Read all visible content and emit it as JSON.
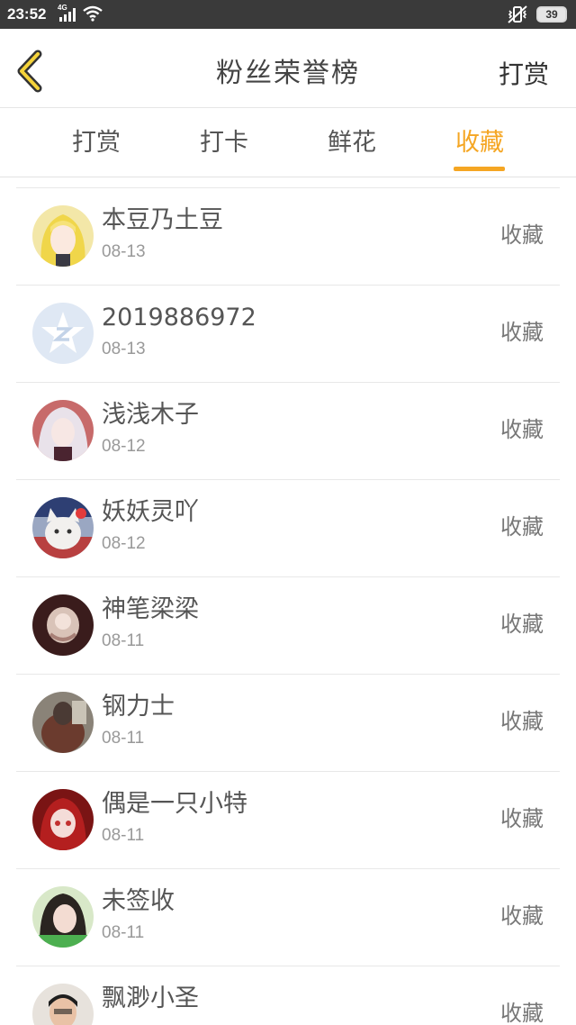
{
  "status_bar": {
    "time": "23:52",
    "network": "4G",
    "battery": "39"
  },
  "header": {
    "title": "粉丝荣誉榜",
    "action_label": "打赏",
    "back_icon": "chevron-left-icon",
    "accent_color": "#f5a623"
  },
  "tabs": [
    {
      "label": "打赏",
      "active": false
    },
    {
      "label": "打卡",
      "active": false
    },
    {
      "label": "鲜花",
      "active": false
    },
    {
      "label": "收藏",
      "active": true
    }
  ],
  "list": {
    "items": [
      {
        "name": "本豆乃土豆",
        "date": "08-13",
        "action": "收藏"
      },
      {
        "name": "2019886972",
        "date": "08-13",
        "action": "收藏"
      },
      {
        "name": "浅浅木子",
        "date": "08-12",
        "action": "收藏"
      },
      {
        "name": "妖妖灵吖",
        "date": "08-12",
        "action": "收藏"
      },
      {
        "name": "神笔梁梁",
        "date": "08-11",
        "action": "收藏"
      },
      {
        "name": "钢力士",
        "date": "08-11",
        "action": "收藏"
      },
      {
        "name": "偶是一只小特",
        "date": "08-11",
        "action": "收藏"
      },
      {
        "name": "未签收",
        "date": "08-11",
        "action": "收藏"
      },
      {
        "name": "飘渺小圣",
        "date": "",
        "action": "收藏"
      }
    ]
  }
}
